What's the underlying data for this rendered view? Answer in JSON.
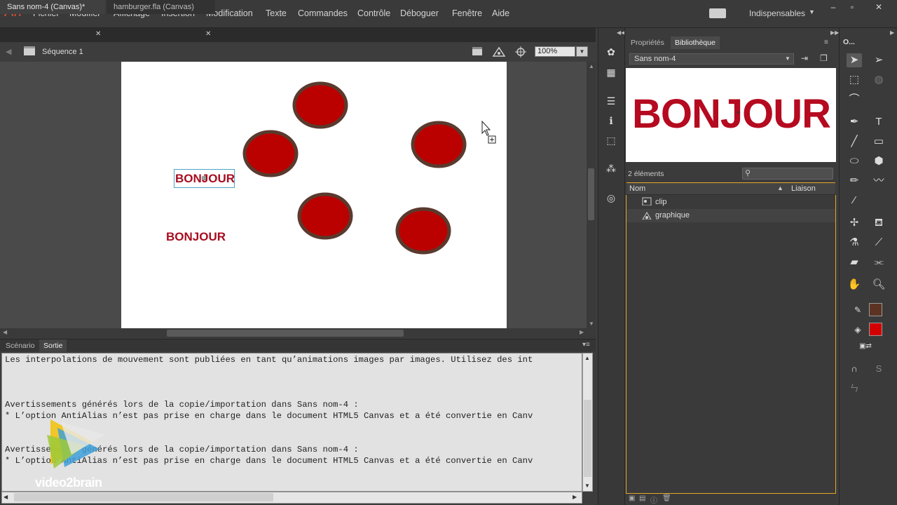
{
  "app": {
    "logo": "An"
  },
  "menu": [
    "Fichier",
    "Modifier",
    "Affichage",
    "Insertion",
    "Modification",
    "Texte",
    "Commandes",
    "Contrôle",
    "Déboguer",
    "Fenêtre",
    "Aide"
  ],
  "workspace": "Indispensables",
  "window_buttons": [
    "–",
    "▫",
    "✕"
  ],
  "doc_tabs": [
    {
      "label": "Sans nom-4 (Canvas)*",
      "close": "✕"
    },
    {
      "label": "hamburger.fla (Canvas)",
      "close": "✕"
    }
  ],
  "editbar": {
    "scene": "Séquence 1",
    "zoom": "100%"
  },
  "stage": {
    "bonjour_selected": "BONJOUR",
    "bonjour_plain": "BONJOUR",
    "circle_fill": "#bb0000",
    "circle_stroke": "#5a3a2e"
  },
  "bottom_tabs": [
    "Scénario",
    "Sortie"
  ],
  "output_lines": [
    "Les interpolations de mouvement sont publiées en tant qu’animations images par images. Utilisez des int",
    "",
    "",
    "",
    "Avertissements générés lors de la copie/importation dans Sans nom-4 :",
    "* L’option AntiAlias n’est pas prise en charge dans le document HTML5 Canvas et a été convertie en Canv",
    "",
    "",
    "Avertissements générés lors de la copie/importation dans Sans nom-4 :",
    "* L’option AntiAlias n’est pas prise en charge dans le document HTML5 Canvas et a été convertie en Canv"
  ],
  "library": {
    "tabs": [
      "Propriétés",
      "Bibliothèque"
    ],
    "document": "Sans nom-4",
    "preview_text": "BONJOUR",
    "count": "2 éléments",
    "col_name": "Nom",
    "col_link": "Liaison",
    "items": [
      {
        "name": "clip",
        "icon": "movieclip-icon"
      },
      {
        "name": "graphique",
        "icon": "graphic-icon"
      }
    ]
  },
  "tools": {
    "title": "O...",
    "stroke_color": "#5c3322",
    "fill_color": "#d40000"
  },
  "watermark": "video2brain"
}
